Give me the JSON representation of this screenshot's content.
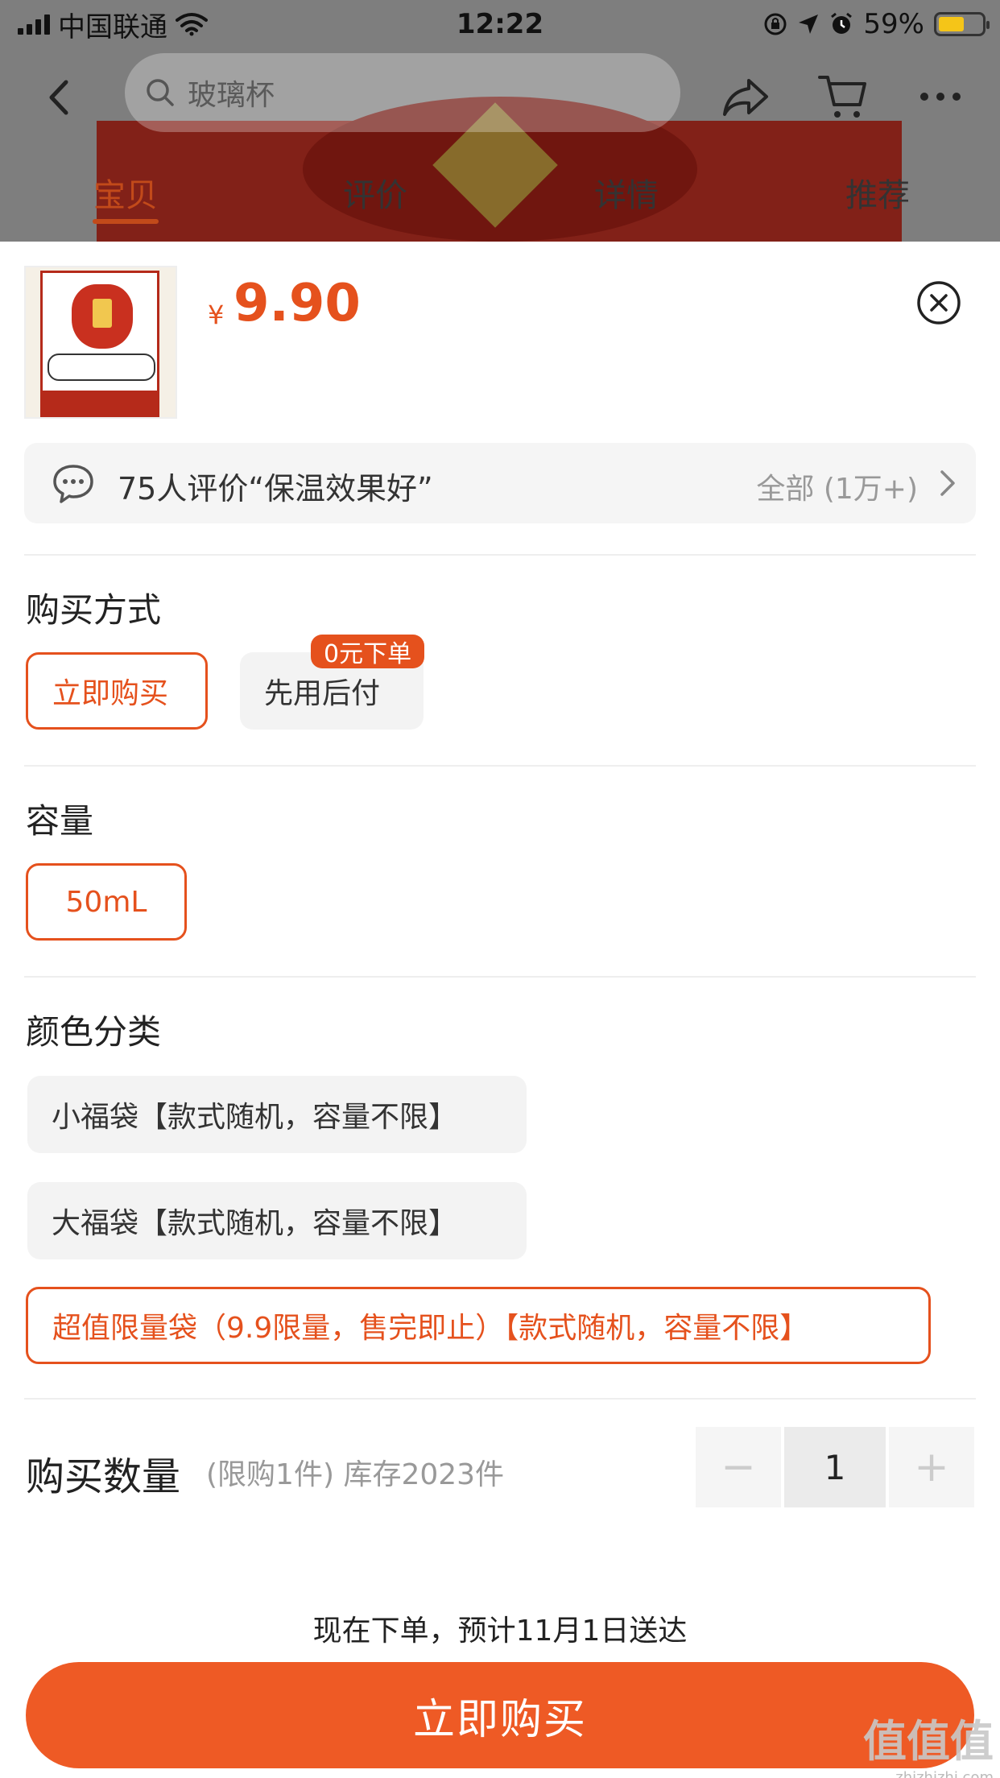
{
  "status_bar": {
    "carrier": "中国联通",
    "time": "12:22",
    "battery": "59%",
    "battery_level": 0.59
  },
  "nav": {
    "search_placeholder": "玻璃杯"
  },
  "tabs": [
    {
      "label": "宝贝",
      "active": true
    },
    {
      "label": "评价",
      "active": false
    },
    {
      "label": "详情",
      "active": false
    },
    {
      "label": "推荐",
      "active": false
    }
  ],
  "product": {
    "currency": "¥",
    "price": "9.90"
  },
  "review": {
    "summary": "75人评价“保温效果好”",
    "all": "全部 (1万+)"
  },
  "purchase_method": {
    "title": "购买方式",
    "options": [
      {
        "label": "立即购买",
        "selected": true
      },
      {
        "label": "先用后付",
        "selected": false,
        "badge": "0元下单"
      }
    ]
  },
  "capacity": {
    "title": "容量",
    "options": [
      {
        "label": "50mL",
        "selected": true
      }
    ]
  },
  "color": {
    "title": "颜色分类",
    "options": [
      {
        "label": "小福袋【款式随机，容量不限】",
        "selected": false
      },
      {
        "label": "大福袋【款式随机，容量不限】",
        "selected": false
      },
      {
        "label": "超值限量袋（9.9限量，售完即止）【款式随机，容量不限】",
        "selected": true
      }
    ]
  },
  "quantity": {
    "title": "购买数量",
    "note": "(限购1件) 库存2023件",
    "minus": "−",
    "value": "1",
    "plus": "+"
  },
  "delivery": "现在下单，预计11月1日送达",
  "buy_button": "立即购买",
  "watermark": {
    "logo": "值值值",
    "url": "zhizhizhi.com"
  },
  "colors": {
    "accent": "#e5511d",
    "button": "#ee5a25",
    "battery": "#f5c518"
  }
}
